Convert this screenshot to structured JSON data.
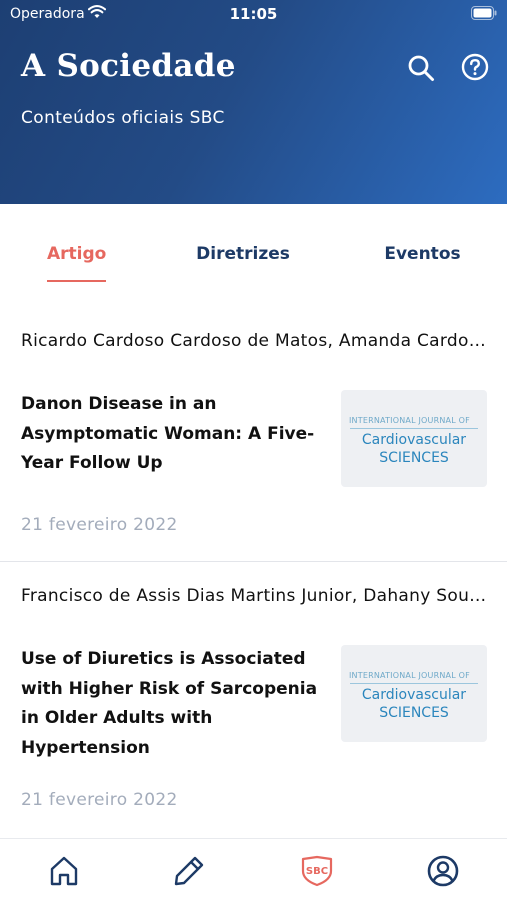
{
  "status_bar": {
    "carrier": "Operadora",
    "time": "11:05"
  },
  "header": {
    "title": "A Sociedade",
    "subtitle": "Conteúdos oficiais SBC"
  },
  "tabs": [
    {
      "label": "Artigo",
      "active": true
    },
    {
      "label": "Diretrizes",
      "active": false
    },
    {
      "label": "Eventos",
      "active": false
    }
  ],
  "articles": [
    {
      "authors": "Ricardo Cardoso Cardoso de Matos, Amanda Cardoso",
      "title": "Danon Disease in an Asymptomatic Woman: A Five-Year Follow Up",
      "date": "21 fevereiro 2022",
      "thumbnail": {
        "journal": "INTERNATIONAL JOURNAL OF",
        "line1": "Cardiovascular",
        "line2": "SCIENCES"
      }
    },
    {
      "authors": "Francisco de Assis Dias Martins Junior, Dahany Souza",
      "title": "Use of Diuretics is Associated with Higher Risk of Sarcopenia in Older Adults with Hypertension",
      "date": "21 fevereiro 2022",
      "thumbnail": {
        "journal": "INTERNATIONAL JOURNAL OF",
        "line1": "Cardiovascular",
        "line2": "SCIENCES"
      }
    }
  ],
  "tabbar": [
    {
      "icon": "home-icon"
    },
    {
      "icon": "pencil-icon"
    },
    {
      "icon": "sbc-logo-icon",
      "label": "SBC",
      "active": true
    },
    {
      "icon": "profile-icon"
    }
  ],
  "colors": {
    "accent": "#e6685f",
    "navy": "#1d3a66",
    "header_start": "#1d3f73",
    "header_end": "#2d6cc0",
    "date_gray": "#a3acbb"
  }
}
